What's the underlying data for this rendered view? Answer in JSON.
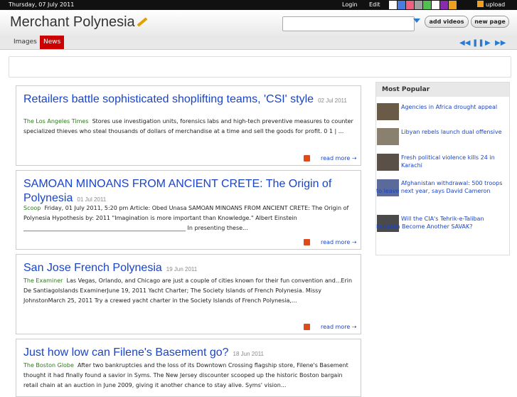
{
  "topbar": {
    "date": "Thursday, 07 July 2011",
    "login": "Login",
    "edit": "Edit",
    "upload": "upload",
    "swatches": [
      "#ffffff",
      "#4a7be0",
      "#f06080",
      "#a0a0a0",
      "#50c050",
      "#ffffff",
      "#8a2ab0",
      "#f0a020"
    ]
  },
  "header": {
    "site_title": "Merchant Polynesia",
    "search_placeholder": "",
    "add_videos": "add videos",
    "new_page": "new page"
  },
  "nav": {
    "tabs": [
      {
        "label": "Images",
        "active": false
      },
      {
        "label": "News",
        "active": true
      }
    ],
    "controls": [
      "◀◀",
      "❚❚",
      "▶",
      "▶▶"
    ]
  },
  "articles": [
    {
      "title": "Retailers battle sophisticated shoplifting teams, 'CSI' style",
      "date": "02 Jul 2011",
      "source": "The Los Angeles Times",
      "body": "Stores use investigation units, forensics labs and high-tech preventive measures to counter specialized thieves who steal thousands of dollars of merchandise at a time and sell the goods for profit. 0 1 | ...",
      "read_more": "read more"
    },
    {
      "title": "SAMOAN MINOANS FROM ANCIENT CRETE: The Origin of Polynesia",
      "date": "01 Jul 2011",
      "source": "Scoop",
      "body": "Friday, 01 July 2011, 5:20 pm Article: Obed Unasa SAMOAN MINOANS FROM ANCIENT CRETE: The Origin of Polynesia Hypothesis by: 2011 \"Imagination is more important than Knowledge.\" Albert Einstein _________________________________________________________ In presenting these...",
      "read_more": "read more"
    },
    {
      "title": "San Jose French Polynesia",
      "date": "19 Jun 2011",
      "source": "The Examiner",
      "body": "Las Vegas, Orlando, and Chicago are just a couple of cities known for their fun convention and...Erin De SantiagoIslands ExaminerJune 19, 2011 Yacht Charter; The Society Islands of French Polynesia. Missy JohnstonMarch 25, 2011 Try a crewed yacht charter in the Society Islands of French Polynesia,...",
      "read_more": "read more"
    },
    {
      "title": "Just how low can Filene's Basement go?",
      "date": "18 Jun 2011",
      "source": "The Boston Globe",
      "body": "After two bankruptcies and the loss of its Downtown Crossing flagship store, Filene's Basement thought it had finally found a savior in Syms. The New Jersey discounter scooped up the historic Boston bargain retail chain at an auction in June 2009, giving it another chance to stay alive. Syms' vision...",
      "read_more": "read more"
    }
  ],
  "sidebar": {
    "heading": "Most Popular",
    "items": [
      {
        "text": "Agencies in Africa drought appeal"
      },
      {
        "text": "Libyan rebels launch dual offensive"
      },
      {
        "text": "Fresh political violence kills 24 in Karachi"
      },
      {
        "text": "Afghanistan withdrawal: 500 troops to leave next year, says David Cameron"
      },
      {
        "text": "Will the CIA's Tehrik-e-Taliban Pakistan Become Another SAVAK?"
      }
    ]
  }
}
